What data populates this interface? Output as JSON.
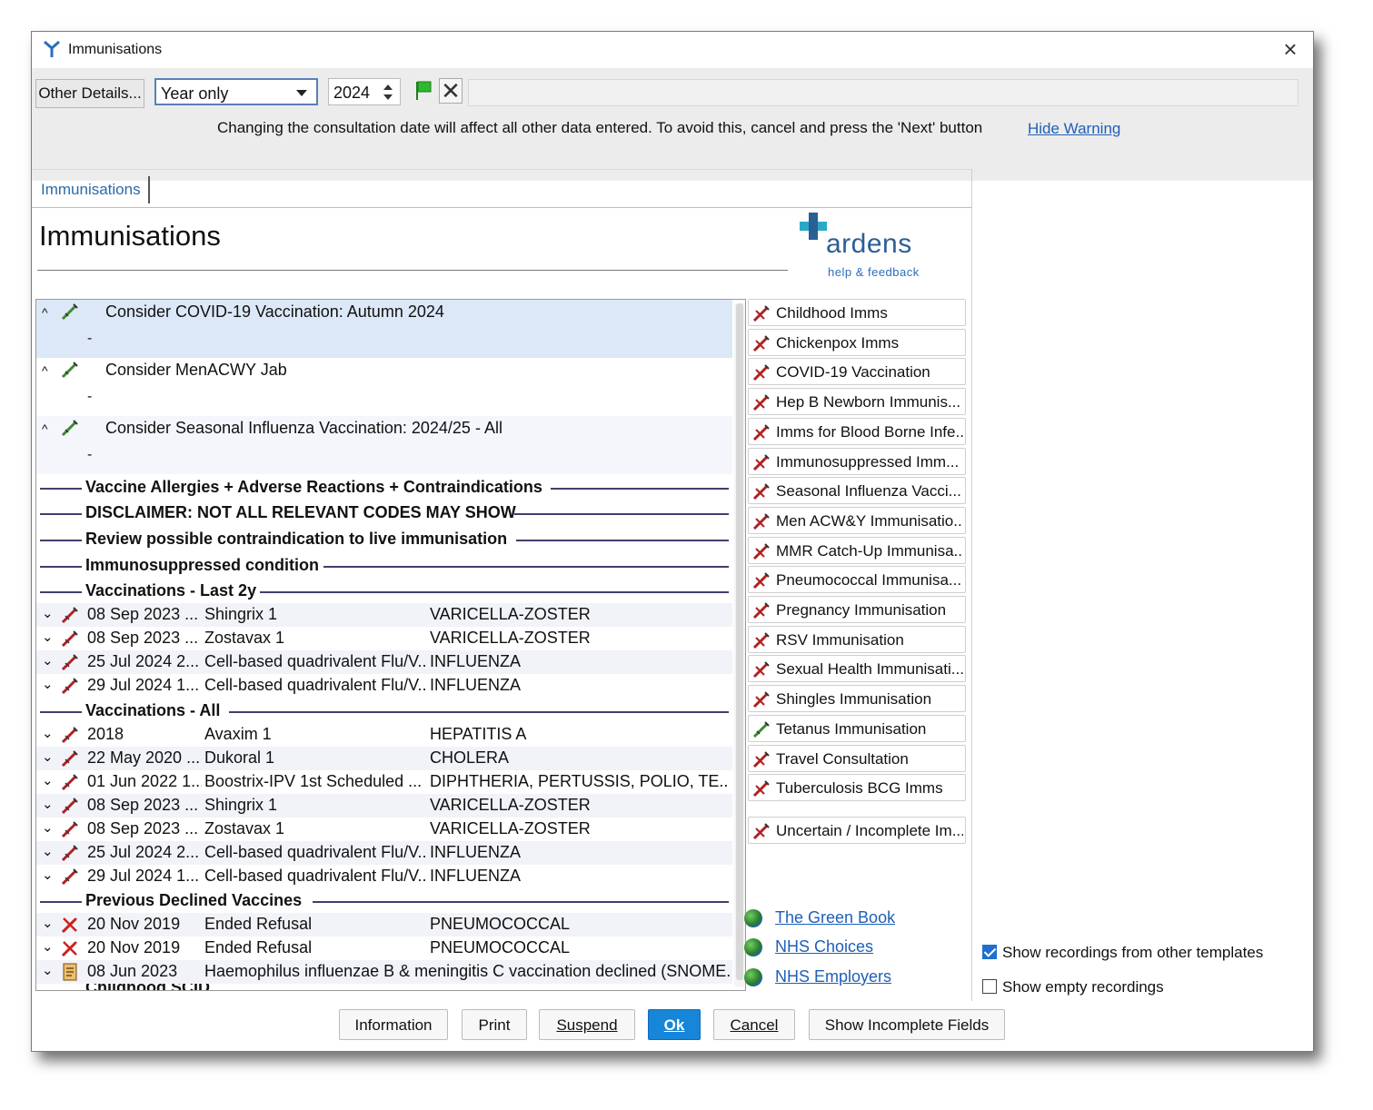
{
  "window": {
    "title": "Immunisations"
  },
  "toolbar": {
    "other_details": "Other Details...",
    "date_mode": "Year only",
    "year": "2024",
    "warning": "Changing the consultation date will affect all other data entered. To avoid this, cancel and press the 'Next' button",
    "hide_warning": "Hide Warning"
  },
  "tab": {
    "label": "Immunisations"
  },
  "page": {
    "title": "Immunisations"
  },
  "logo": {
    "name": "ardens",
    "sub": "help & feedback"
  },
  "considerations": [
    {
      "text": "Consider COVID-19 Vaccination: Autumn 2024",
      "value": "-"
    },
    {
      "text": "Consider MenACWY Jab",
      "value": "-"
    },
    {
      "text": "Consider Seasonal Influenza Vaccination: 2024/25 - All",
      "value": "-"
    }
  ],
  "sections": {
    "allergies": "Vaccine Allergies + Adverse Reactions + Contraindications",
    "disclaimer": "DISCLAIMER: NOT ALL RELEVANT CODES MAY SHOW",
    "review": "Review possible contraindication to live immunisation",
    "immunosuppressed": "Immunosuppressed condition",
    "last2y": "Vaccinations - Last 2y",
    "all": "Vaccinations - All",
    "declined": "Previous Declined Vaccines"
  },
  "last2y": [
    {
      "date": "08 Sep 2023 ...",
      "name": "Shingrix 1",
      "category": "VARICELLA-ZOSTER"
    },
    {
      "date": "08 Sep 2023 ...",
      "name": "Zostavax 1",
      "category": "VARICELLA-ZOSTER"
    },
    {
      "date": "25 Jul 2024 2...",
      "name": "Cell-based quadrivalent Flu/V...",
      "category": "INFLUENZA"
    },
    {
      "date": "29 Jul 2024 1...",
      "name": "Cell-based quadrivalent Flu/V...",
      "category": "INFLUENZA"
    }
  ],
  "all": [
    {
      "date": "2018",
      "name": "Avaxim 1",
      "category": "HEPATITIS A"
    },
    {
      "date": "22 May 2020 ...",
      "name": "Dukoral 1",
      "category": "CHOLERA"
    },
    {
      "date": "01 Jun 2022 1...",
      "name": "Boostrix-IPV 1st Scheduled ...",
      "category": "DIPHTHERIA, PERTUSSIS, POLIO, TE..."
    },
    {
      "date": "08 Sep 2023 ...",
      "name": "Shingrix 1",
      "category": "VARICELLA-ZOSTER"
    },
    {
      "date": "08 Sep 2023 ...",
      "name": "Zostavax 1",
      "category": "VARICELLA-ZOSTER"
    },
    {
      "date": "25 Jul 2024 2...",
      "name": "Cell-based quadrivalent Flu/V...",
      "category": "INFLUENZA"
    },
    {
      "date": "29 Jul 2024 1...",
      "name": "Cell-based quadrivalent Flu/V...",
      "category": "INFLUENZA"
    }
  ],
  "declined": [
    {
      "date": "20 Nov 2019",
      "name": "Ended Refusal",
      "category": "PNEUMOCOCCAL"
    },
    {
      "date": "20 Nov 2019",
      "name": "Ended Refusal",
      "category": "PNEUMOCOCCAL"
    },
    {
      "date": "08 Jun 2023",
      "name": "Haemophilus influenzae B & meningitis C vaccination declined (SNOME..."
    }
  ],
  "partial_row": "Childhood SCID",
  "side_buttons": [
    "Childhood Imms",
    "Chickenpox Imms",
    "COVID-19 Vaccination",
    "Hep B Newborn Immunis...",
    "Imms for Blood Borne Infe...",
    "Immunosuppressed Imm...",
    "Seasonal Influenza Vacci...",
    "Men ACW&Y Immunisatio...",
    "MMR Catch-Up Immunisa...",
    "Pneumococcal Immunisa...",
    "Pregnancy Immunisation",
    "RSV Immunisation",
    "Sexual Health Immunisati...",
    "Shingles Immunisation",
    "Tetanus Immunisation",
    "Travel Consultation",
    "Tuberculosis BCG Imms"
  ],
  "uncertain_button": "Uncertain / Incomplete Im...",
  "links": [
    "The Green Book",
    "NHS Choices",
    "NHS Employers"
  ],
  "checkboxes": {
    "other_templates": {
      "label": "Show recordings from other templates",
      "checked": true
    },
    "empty": {
      "label": "Show empty recordings",
      "checked": false
    }
  },
  "buttons": {
    "information": "Information",
    "print": "Print",
    "suspend": "Suspend",
    "ok": "Ok",
    "cancel": "Cancel",
    "incomplete": "Show Incomplete Fields"
  },
  "colors": {
    "accent": "#1786d9",
    "link": "#1f5fb8",
    "section_line": "#3f3f6f"
  }
}
